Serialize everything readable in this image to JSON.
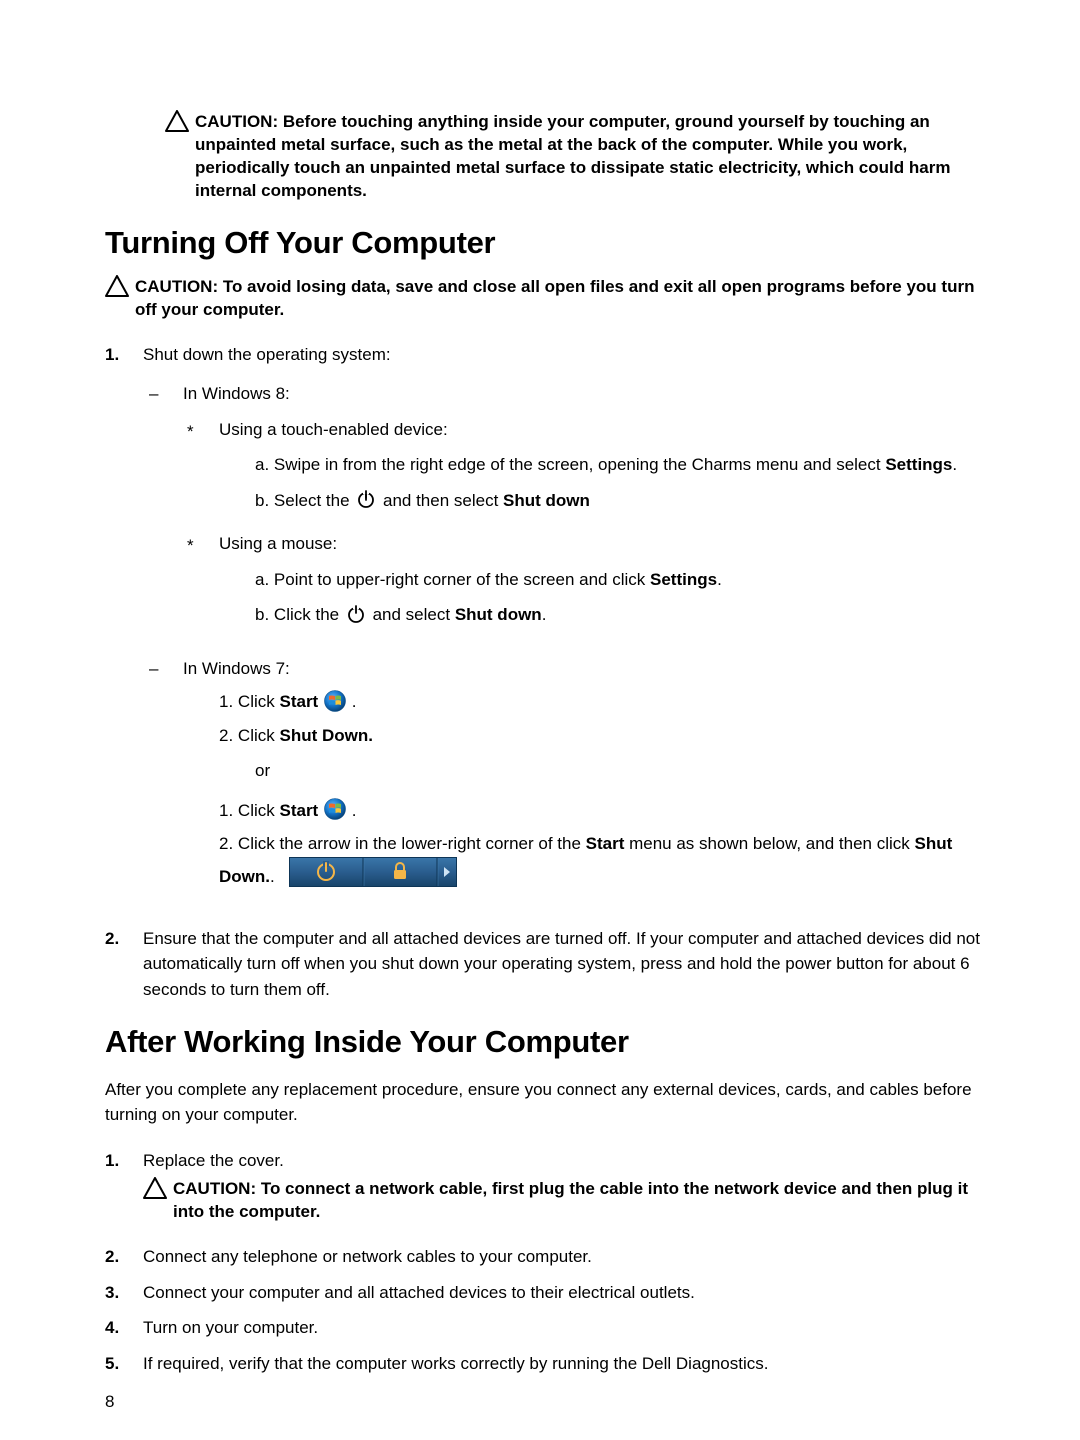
{
  "cautions": {
    "top": "CAUTION: Before touching anything inside your computer, ground yourself by touching an unpainted metal surface, such as the metal at the back of the computer. While you work, periodically touch an unpainted metal surface to dissipate static electricity, which could harm internal components.",
    "turning_off": "CAUTION: To avoid losing data, save and close all open files and exit all open programs before you turn off your computer.",
    "network": "CAUTION: To connect a network cable, first plug the cable into the network device and then plug it into the computer."
  },
  "headings": {
    "turning_off": "Turning Off Your Computer",
    "after_working": "After Working Inside Your Computer"
  },
  "turn_off": {
    "step1_text": "Shut down the operating system:",
    "win8_label": "In Windows 8:",
    "win8_touch_label": "Using a touch-enabled device:",
    "win8_touch_a_pre": "Swipe in from the right edge of the screen, opening the Charms menu and select ",
    "win8_touch_a_bold": "Settings",
    "win8_touch_a_end": ".",
    "win8_touch_b_pre": "Select the ",
    "win8_touch_b_mid": " and then select ",
    "win8_touch_b_bold": "Shut down",
    "win8_mouse_label": "Using a mouse:",
    "win8_mouse_a_pre": "Point to upper-right corner of the screen and click ",
    "win8_mouse_a_bold": "Settings",
    "win8_mouse_a_end": ".",
    "win8_mouse_b_pre": "Click the ",
    "win8_mouse_b_mid": " and select ",
    "win8_mouse_b_bold": "Shut down",
    "win8_mouse_b_end": ".",
    "win7_label": "In Windows 7:",
    "win7_a1_pre": "Click ",
    "win7_a1_bold": "Start",
    "win7_a1_end": " .",
    "win7_a2_pre": "Click ",
    "win7_a2_bold": "Shut Down.",
    "or": "or",
    "win7_b1_pre": "Click ",
    "win7_b1_bold": "Start",
    "win7_b1_end": " .",
    "win7_b2_pre": "Click the arrow in the lower-right corner of the ",
    "win7_b2_bold1": "Start",
    "win7_b2_mid": " menu as shown below, and then click ",
    "win7_b2_bold2": "Shut",
    "win7_b2_bold3": "Down.",
    "win7_b2_tail": ".",
    "step2_text": "Ensure that the computer and all attached devices are turned off. If your computer and attached devices did not automatically turn off when you shut down your operating system, press and hold the power button for about 6 seconds to turn them off."
  },
  "after": {
    "intro": "After you complete any replacement procedure, ensure you connect any external devices, cards, and cables before turning on your computer.",
    "s1": "Replace the cover.",
    "s2": "Connect any telephone or network cables to your computer.",
    "s3": "Connect your computer and all attached devices to their electrical outlets.",
    "s4": "Turn on your computer.",
    "s5": "If required, verify that the computer works correctly by running the Dell Diagnostics."
  },
  "labels": {
    "a": "a.",
    "b": "b.",
    "n1": "1.",
    "n2": "2.",
    "n3": "3.",
    "n4": "4.",
    "n5": "5."
  },
  "page_number": "8"
}
